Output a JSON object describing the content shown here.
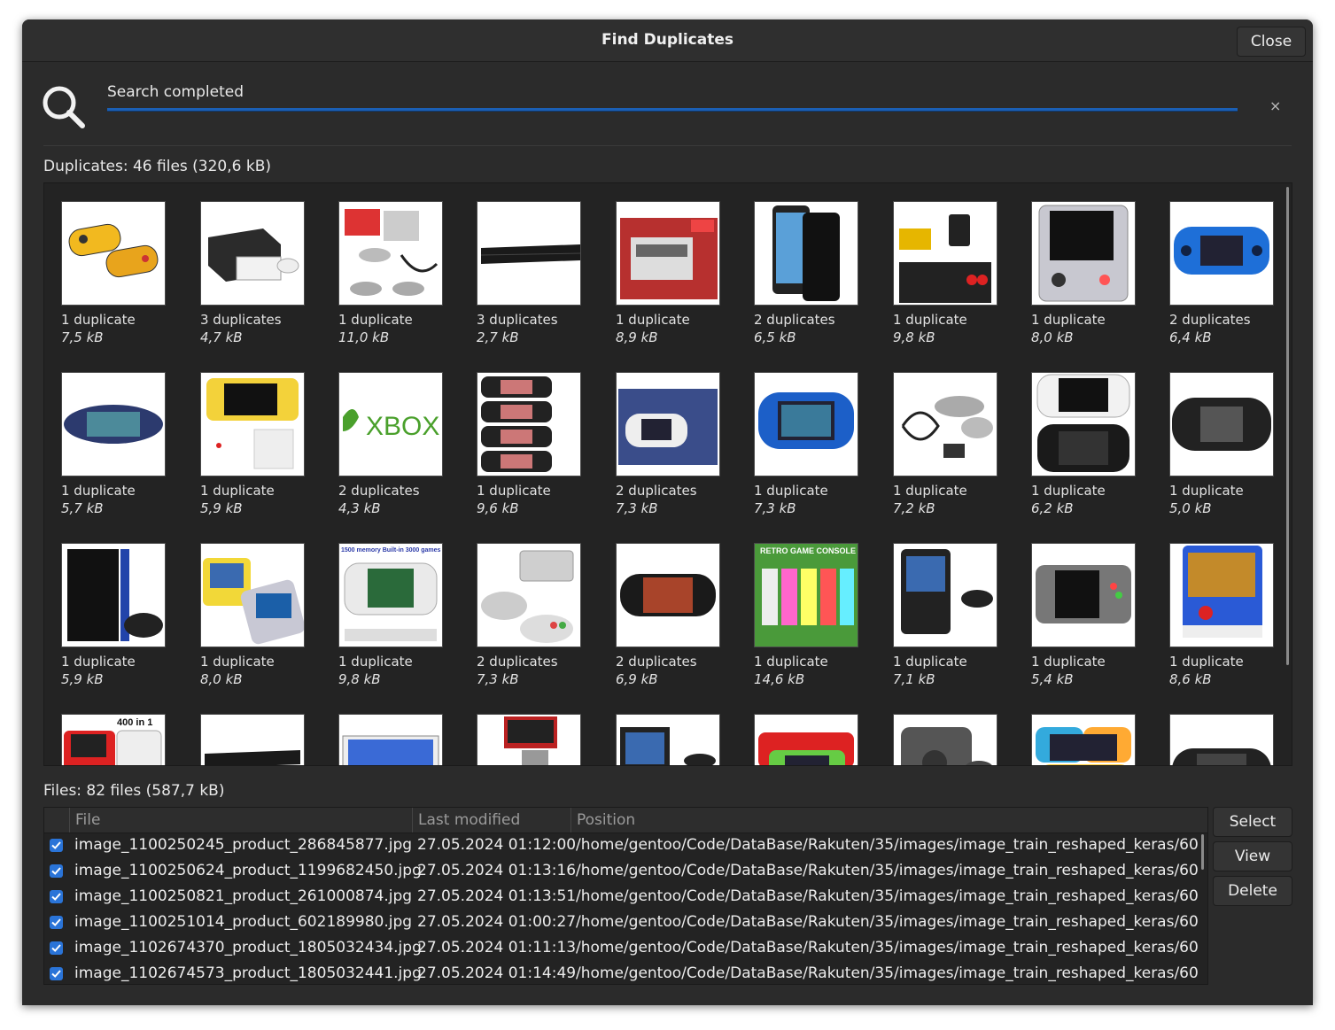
{
  "window": {
    "title": "Find Duplicates",
    "close_label": "Close"
  },
  "search": {
    "status": "Search completed",
    "progress": 1.0,
    "dismiss_glyph": "×"
  },
  "duplicates": {
    "label": "Duplicates: 46 files (320,6 kB)",
    "items": [
      {
        "count": "1 duplicate",
        "size": "7,5 kB",
        "icon": "handheld-pair-image"
      },
      {
        "count": "3 duplicates",
        "size": "4,7 kB",
        "icon": "xbox-console-image"
      },
      {
        "count": "1 duplicate",
        "size": "11,0 kB",
        "icon": "retro-console-kit-image"
      },
      {
        "count": "3 duplicates",
        "size": "2,7 kB",
        "icon": "playstation-console-image"
      },
      {
        "count": "1 duplicate",
        "size": "8,9 kB",
        "icon": "nes-mini-box-image"
      },
      {
        "count": "2 duplicates",
        "size": "6,5 kB",
        "icon": "smartphone-image"
      },
      {
        "count": "1 duplicate",
        "size": "9,8 kB",
        "icon": "tv-stick-image"
      },
      {
        "count": "1 duplicate",
        "size": "8,0 kB",
        "icon": "handheld-clear-image"
      },
      {
        "count": "2 duplicates",
        "size": "6,4 kB",
        "icon": "blue-handheld-image"
      },
      {
        "count": "1 duplicate",
        "size": "5,7 kB",
        "icon": "oval-handheld-image"
      },
      {
        "count": "1 duplicate",
        "size": "5,9 kB",
        "icon": "yellow-handheld-image"
      },
      {
        "count": "2 duplicates",
        "size": "4,3 kB",
        "icon": "xbox-logo-image"
      },
      {
        "count": "1 duplicate",
        "size": "9,6 kB",
        "icon": "psp-stack-image"
      },
      {
        "count": "2 duplicates",
        "size": "7,3 kB",
        "icon": "handheld-box-image"
      },
      {
        "count": "1 duplicate",
        "size": "7,3 kB",
        "icon": "blue-psp-image"
      },
      {
        "count": "1 duplicate",
        "size": "7,2 kB",
        "icon": "controllers-cable-image"
      },
      {
        "count": "1 duplicate",
        "size": "6,2 kB",
        "icon": "psp-pair-image"
      },
      {
        "count": "1 duplicate",
        "size": "5,0 kB",
        "icon": "black-psp-image"
      },
      {
        "count": "1 duplicate",
        "size": "5,9 kB",
        "icon": "ps4-controller-image"
      },
      {
        "count": "1 duplicate",
        "size": "8,0 kB",
        "icon": "yellow-handheld-pair-image"
      },
      {
        "count": "1 duplicate",
        "size": "9,8 kB",
        "icon": "white-handheld-image"
      },
      {
        "count": "2 duplicates",
        "size": "7,3 kB",
        "icon": "snes-controllers-image"
      },
      {
        "count": "2 duplicates",
        "size": "6,9 kB",
        "icon": "wide-handheld-image"
      },
      {
        "count": "1 duplicate",
        "size": "14,6 kB",
        "icon": "retro-game-console-image"
      },
      {
        "count": "1 duplicate",
        "size": "7,1 kB",
        "icon": "gameboy-style-image"
      },
      {
        "count": "1 duplicate",
        "size": "5,4 kB",
        "icon": "grey-handheld-image"
      },
      {
        "count": "1 duplicate",
        "size": "8,6 kB",
        "icon": "arcade-mini-image"
      },
      {
        "count": "",
        "size": "",
        "icon": "red-handheld-image"
      },
      {
        "count": "",
        "size": "",
        "icon": "black-console-image"
      },
      {
        "count": "",
        "size": "",
        "icon": "widescreen-handheld-image"
      },
      {
        "count": "",
        "size": "",
        "icon": "boxed-console-image"
      },
      {
        "count": "",
        "size": "",
        "icon": "handheld-gamepad-image"
      },
      {
        "count": "",
        "size": "",
        "icon": "color-handhelds-image"
      },
      {
        "count": "",
        "size": "",
        "icon": "gamecube-image"
      },
      {
        "count": "",
        "size": "",
        "icon": "switch-style-image"
      },
      {
        "count": "",
        "size": "",
        "icon": "psvita-image"
      }
    ],
    "top_labels": [
      "1500 memory Built-in 3000 games",
      "RETRO GAME CONSOLE",
      "400 in 1"
    ]
  },
  "files": {
    "label": "Files: 82 files (587,7 kB)",
    "columns": [
      "File",
      "Last modified",
      "Position"
    ],
    "rows": [
      {
        "file": "image_1100250245_product_286845877.jpg",
        "modified": "27.05.2024 01:12:00",
        "position": "/home/gentoo/Code/DataBase/Rakuten/35/images/image_train_reshaped_keras/60",
        "checked": true
      },
      {
        "file": "image_1100250624_product_1199682450.jpg",
        "modified": "27.05.2024 01:13:16",
        "position": "/home/gentoo/Code/DataBase/Rakuten/35/images/image_train_reshaped_keras/60",
        "checked": true
      },
      {
        "file": "image_1100250821_product_261000874.jpg",
        "modified": "27.05.2024 01:13:51",
        "position": "/home/gentoo/Code/DataBase/Rakuten/35/images/image_train_reshaped_keras/60",
        "checked": true
      },
      {
        "file": "image_1100251014_product_602189980.jpg",
        "modified": "27.05.2024 01:00:27",
        "position": "/home/gentoo/Code/DataBase/Rakuten/35/images/image_train_reshaped_keras/60",
        "checked": true
      },
      {
        "file": "image_1102674370_product_1805032434.jpg",
        "modified": "27.05.2024 01:11:13",
        "position": "/home/gentoo/Code/DataBase/Rakuten/35/images/image_train_reshaped_keras/60",
        "checked": true
      },
      {
        "file": "image_1102674573_product_1805032441.jpg",
        "modified": "27.05.2024 01:14:49",
        "position": "/home/gentoo/Code/DataBase/Rakuten/35/images/image_train_reshaped_keras/60",
        "checked": true
      }
    ]
  },
  "actions": {
    "select_label": "Select",
    "view_label": "View",
    "delete_label": "Delete"
  }
}
